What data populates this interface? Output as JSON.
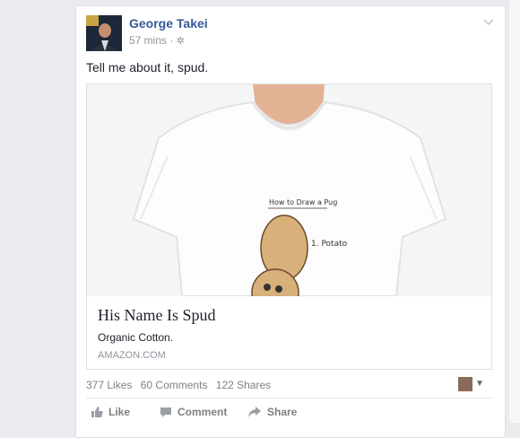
{
  "post": {
    "author": "George Takei",
    "time": "57 mins",
    "separator": "·",
    "privacy_icon": "gear-globe-icon",
    "text": "Tell me about it, spud."
  },
  "link": {
    "image_text": {
      "heading": "How to Draw a Pug",
      "step1": "1. Potato"
    },
    "title": "His Name Is Spud",
    "description": "Organic Cotton.",
    "domain": "AMAZON.COM"
  },
  "counts": {
    "likes": "377 Likes",
    "comments": "60 Comments",
    "shares": "122 Shares"
  },
  "actions": {
    "like": "Like",
    "comment": "Comment",
    "share": "Share"
  },
  "colors": {
    "author_link": "#365899",
    "secondary_text": "#90949c",
    "page_bg": "#e9ebee"
  }
}
